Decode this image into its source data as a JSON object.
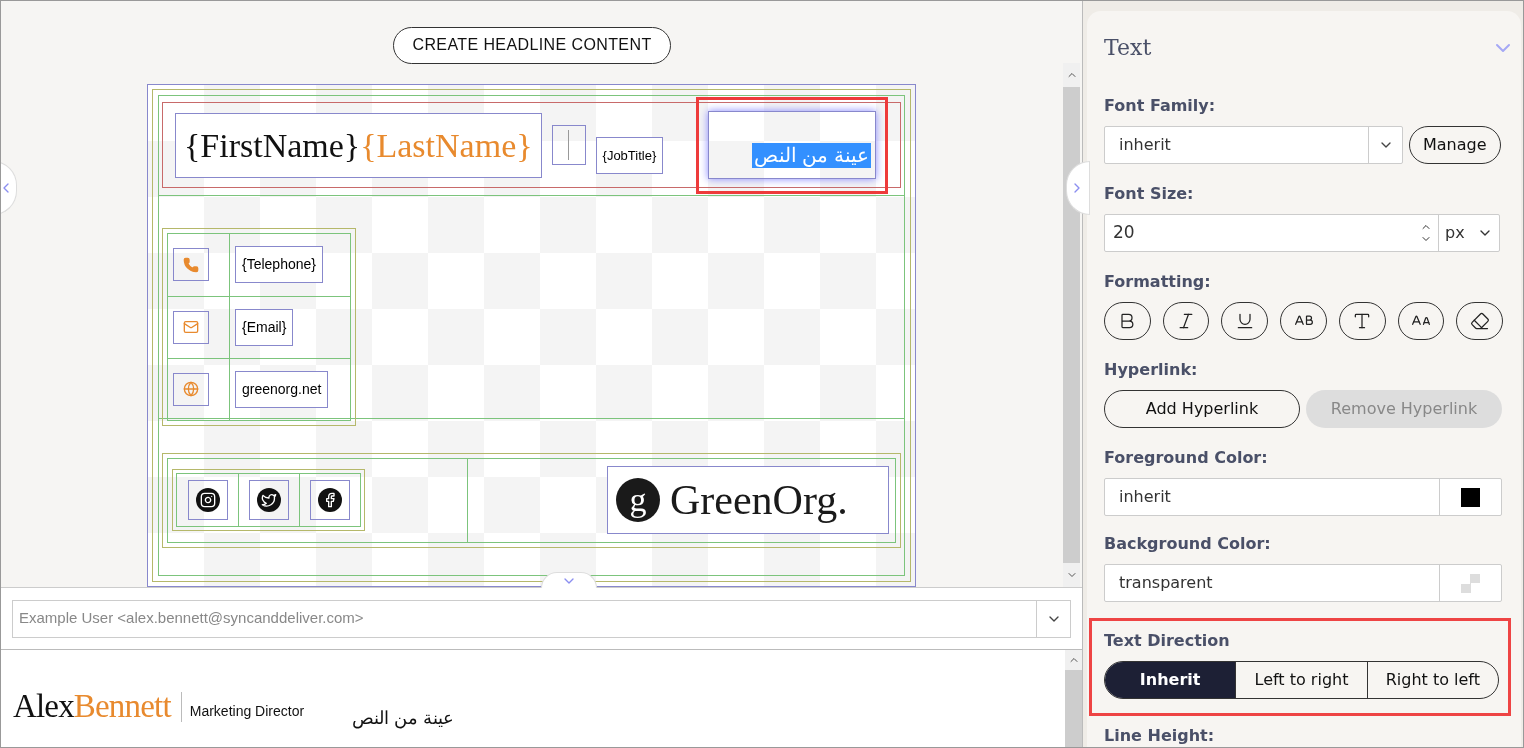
{
  "canvas": {
    "create_button": "CREATE HEADLINE CONTENT",
    "header": {
      "first_name": "{FirstName}",
      "last_name": "{LastName}",
      "job_title": "{JobTitle}",
      "text_block": "عينة من النص",
      "selected": true
    },
    "contacts": [
      {
        "kind": "phone",
        "text": "{Telephone}"
      },
      {
        "kind": "email",
        "text": "{Email}"
      },
      {
        "kind": "web",
        "text": "greenorg.net"
      }
    ],
    "social": [
      {
        "kind": "instagram"
      },
      {
        "kind": "twitter"
      },
      {
        "kind": "facebook"
      }
    ],
    "logo": {
      "mark": "g",
      "text": "GreenOrg."
    }
  },
  "sender": {
    "placeholder": "Example User <alex.bennett@syncanddeliver.com>"
  },
  "preview": {
    "first_name": "Alex",
    "last_name": "Bennett",
    "job_title": "Marketing Director",
    "text_block": "عينة من النص"
  },
  "panel": {
    "title": "Text",
    "expanded": true,
    "font_family": {
      "label": "Font Family:",
      "value": "inherit",
      "button": "Manage"
    },
    "font_size": {
      "label": "Font Size:",
      "value": "20",
      "unit": "px"
    },
    "formatting": {
      "label": "Formatting:",
      "buttons": [
        {
          "kind": "bold"
        },
        {
          "kind": "italic"
        },
        {
          "kind": "underline"
        },
        {
          "kind": "small-caps"
        },
        {
          "kind": "font"
        },
        {
          "kind": "case"
        },
        {
          "kind": "clear"
        }
      ]
    },
    "hyperlink": {
      "label": "Hyperlink:",
      "buttons": [
        {
          "label": "Add Hyperlink",
          "disabled": false
        },
        {
          "label": "Remove Hyperlink",
          "disabled": true
        }
      ]
    },
    "foreground": {
      "label": "Foreground Color:",
      "value": "inherit"
    },
    "background": {
      "label": "Background Color:",
      "value": "transparent"
    },
    "text_direction": {
      "label": "Text Direction",
      "options": [
        {
          "label": "Inherit",
          "selected": true
        },
        {
          "label": "Left to right",
          "selected": false
        },
        {
          "label": "Right to left",
          "selected": false
        }
      ]
    },
    "line_height": {
      "label": "Line Height:"
    }
  }
}
